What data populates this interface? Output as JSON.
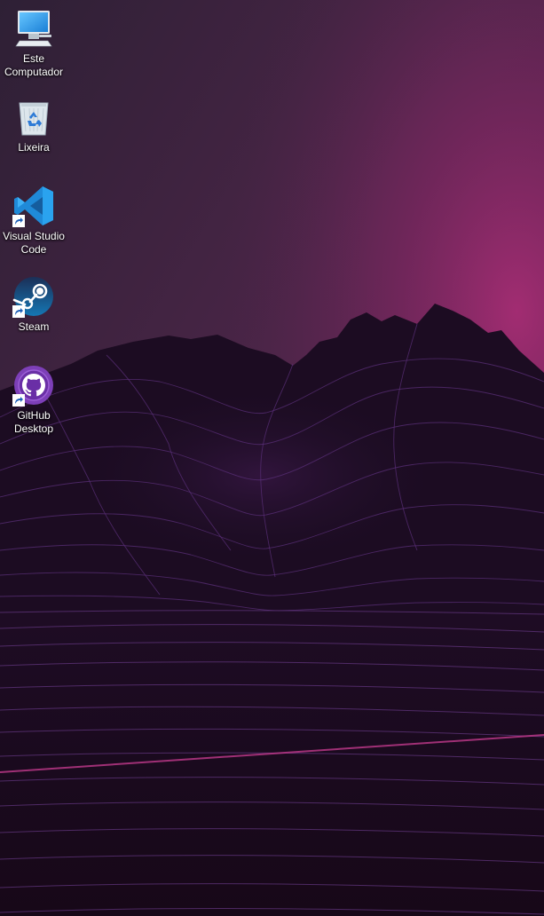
{
  "desktop": {
    "wallpaper": {
      "sky_top": "#3a2440",
      "sky_glow": "#8a2d6a",
      "mountain_fill": "#1b0d22",
      "grid_line": "#6a3a8f",
      "horizon_accent": "#c03a8c"
    },
    "icons": [
      {
        "label": "Este Computador",
        "icon": "computer-icon",
        "shortcut": false
      },
      {
        "label": "Lixeira",
        "icon": "recycle-bin-icon",
        "shortcut": false
      },
      {
        "label": "Visual Studio Code",
        "icon": "vscode-icon",
        "shortcut": true
      },
      {
        "label": "Steam",
        "icon": "steam-icon",
        "shortcut": true
      },
      {
        "label": "GitHub Desktop",
        "icon": "github-desktop-icon",
        "shortcut": true
      }
    ]
  }
}
